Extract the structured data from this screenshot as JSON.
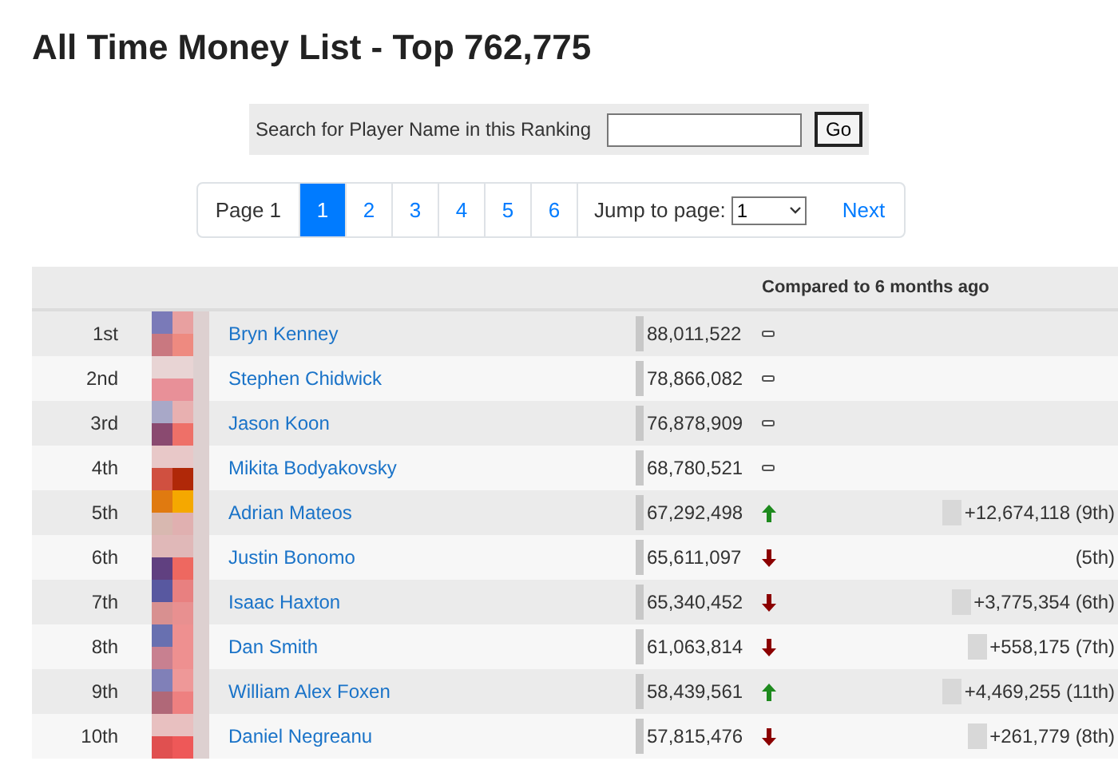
{
  "title": "All Time Money List - Top 762,775",
  "search": {
    "label": "Search for Player Name in this Ranking",
    "button": "Go"
  },
  "pagination": {
    "label": "Page 1",
    "pages": [
      {
        "label": "1",
        "selected": true
      },
      {
        "label": "2",
        "selected": false
      },
      {
        "label": "3",
        "selected": false
      },
      {
        "label": "4",
        "selected": false
      },
      {
        "label": "5",
        "selected": false
      },
      {
        "label": "6",
        "selected": false
      }
    ],
    "jump_label": "Jump to page:",
    "jump_value": "1",
    "next": "Next"
  },
  "table": {
    "header": "Compared to 6 months ago",
    "rows": [
      {
        "rank": "1st",
        "name": "Bryn Kenney",
        "money": "88,011,522",
        "kind": "same"
      },
      {
        "rank": "2nd",
        "name": "Stephen Chidwick",
        "money": "78,866,082",
        "kind": "same"
      },
      {
        "rank": "3rd",
        "name": "Jason Koon",
        "money": "76,878,909",
        "kind": "same"
      },
      {
        "rank": "4th",
        "name": "Mikita Bodyakovsky",
        "money": "68,780,521",
        "kind": "same"
      },
      {
        "rank": "5th",
        "name": "Adrian Mateos",
        "money": "67,292,498",
        "kind": "up",
        "previous": "+12,674,118 (9th)"
      },
      {
        "rank": "6th",
        "name": "Justin Bonomo",
        "money": "65,611,097",
        "kind": "down",
        "previous": "(5th)"
      },
      {
        "rank": "7th",
        "name": "Isaac Haxton",
        "money": "65,340,452",
        "kind": "down",
        "previous": "+3,775,354 (6th)"
      },
      {
        "rank": "8th",
        "name": "Dan Smith",
        "money": "61,063,814",
        "kind": "down",
        "previous": "+558,175 (7th)"
      },
      {
        "rank": "9th",
        "name": "William Alex Foxen",
        "money": "58,439,561",
        "kind": "up",
        "previous": "+4,469,255 (11th)"
      },
      {
        "rank": "10th",
        "name": "Daniel Negreanu",
        "money": "57,815,476",
        "kind": "down",
        "previous": "+261,779 (8th)"
      }
    ]
  }
}
